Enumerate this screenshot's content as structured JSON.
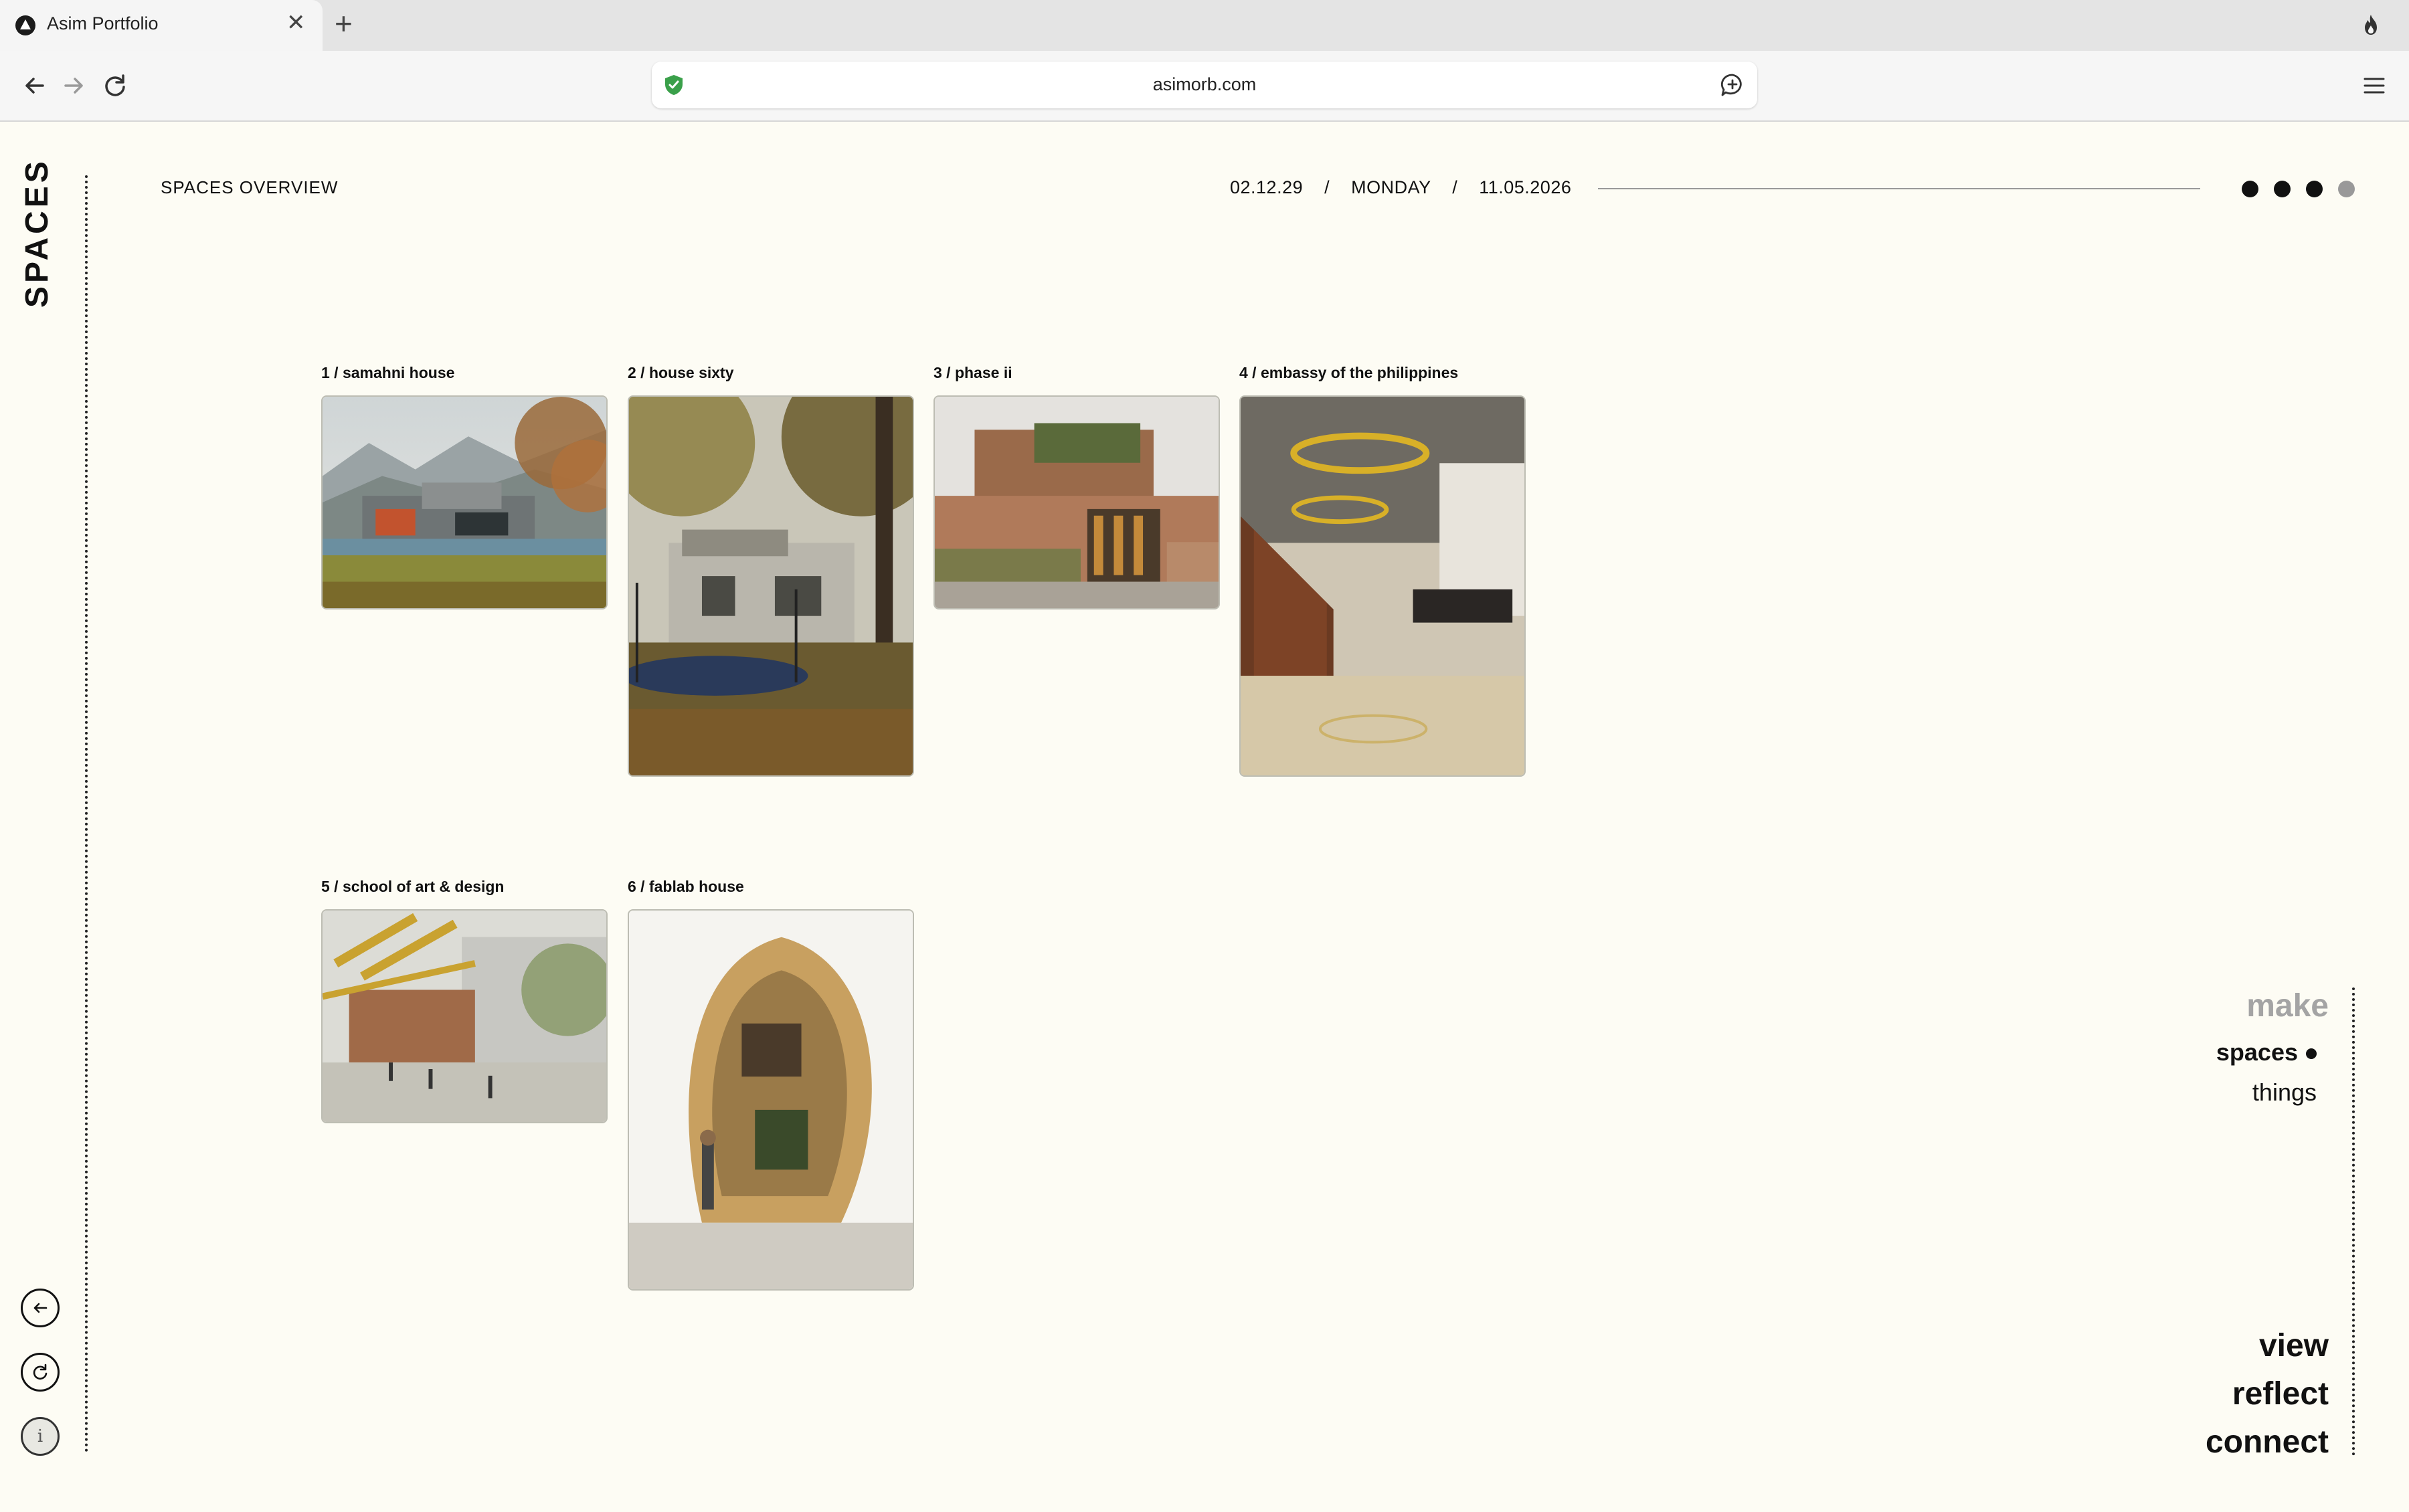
{
  "browser": {
    "tab_title": "Asim Portfolio",
    "tab_close": "✕",
    "new_tab": "+",
    "url": "asimorb.com",
    "icons": [
      "back-arrow-icon",
      "forward-arrow-icon",
      "reload-icon",
      "shield-icon",
      "chat-icon",
      "menu-icon",
      "flame-icon"
    ]
  },
  "sidebar": {
    "title": "SPACES",
    "buttons": [
      {
        "icon": "arrow-left-icon"
      },
      {
        "icon": "refresh-icon"
      },
      {
        "icon": "info-icon",
        "label": "i"
      }
    ]
  },
  "header": {
    "overview": "SPACES OVERVIEW",
    "time": "02.12.29",
    "sep1": "/",
    "day": "MONDAY",
    "sep2": "/",
    "date": "11.05.2026",
    "page_dots": {
      "total": 4,
      "active": 3
    }
  },
  "gallery": [
    {
      "label": "1 / samahni house"
    },
    {
      "label": "2 / house sixty"
    },
    {
      "label": "3 / phase ii"
    },
    {
      "label": "4 / embassy of the philippines"
    },
    {
      "label": "5 / school of art & design"
    },
    {
      "label": "6 / fablab house"
    }
  ],
  "rightnav": {
    "make": "make",
    "spaces": "spaces",
    "things": "things",
    "view": "view",
    "reflect": "reflect",
    "connect": "connect"
  },
  "colors": {
    "background": "#fdfcf4",
    "text": "#111111",
    "muted": "#a4a4a4"
  }
}
